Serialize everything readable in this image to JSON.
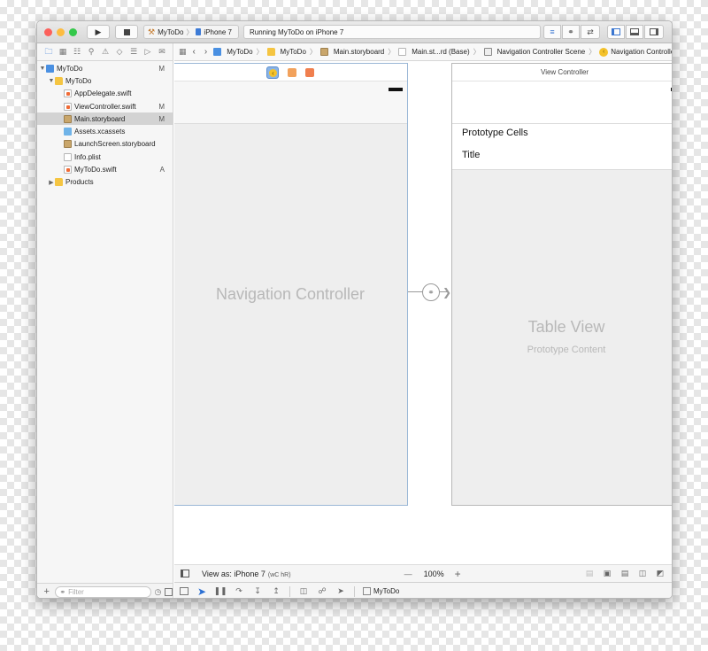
{
  "toolbar": {
    "scheme_app": "MyToDo",
    "scheme_device": "iPhone 7",
    "status_text": "Running MyToDo on iPhone 7",
    "colors": {
      "close": "#fc605b",
      "minimize": "#fdbc40",
      "zoom": "#34c84a"
    }
  },
  "navigator": {
    "items": [
      {
        "label": "MyToDo",
        "badge": "M",
        "icon": "project-icon"
      },
      {
        "label": "MyToDo",
        "badge": "",
        "icon": "folder-icon"
      },
      {
        "label": "AppDelegate.swift",
        "badge": "",
        "icon": "swift-file-icon"
      },
      {
        "label": "ViewController.swift",
        "badge": "M",
        "icon": "swift-file-icon"
      },
      {
        "label": "Main.storyboard",
        "badge": "M",
        "icon": "storyboard-icon"
      },
      {
        "label": "Assets.xcassets",
        "badge": "",
        "icon": "assets-folder-icon"
      },
      {
        "label": "LaunchScreen.storyboard",
        "badge": "",
        "icon": "storyboard-icon"
      },
      {
        "label": "Info.plist",
        "badge": "",
        "icon": "plist-icon"
      },
      {
        "label": "MyToDo.swift",
        "badge": "A",
        "icon": "swift-file-icon"
      },
      {
        "label": "Products",
        "badge": "",
        "icon": "folder-icon"
      }
    ],
    "filter_placeholder": "Filter"
  },
  "jumpbar": {
    "crumbs": [
      "MyToDo",
      "MyToDo",
      "Main.storyboard",
      "Main.st...rd (Base)",
      "Navigation Controller Scene",
      "Navigation Controller"
    ]
  },
  "canvas": {
    "nav_controller_label": "Navigation Controller",
    "view_controller_title": "View Controller",
    "prototype_cells_label": "Prototype Cells",
    "cell_title": "Title",
    "table_view_label": "Table View",
    "prototype_content_label": "Prototype Content"
  },
  "canvas_bottom": {
    "view_as": "View as: iPhone 7",
    "size_class": "(wC hR)",
    "zoom_minus": "—",
    "zoom_level": "100%",
    "zoom_plus": "+"
  },
  "debug_bar": {
    "target": "MyToDo"
  }
}
